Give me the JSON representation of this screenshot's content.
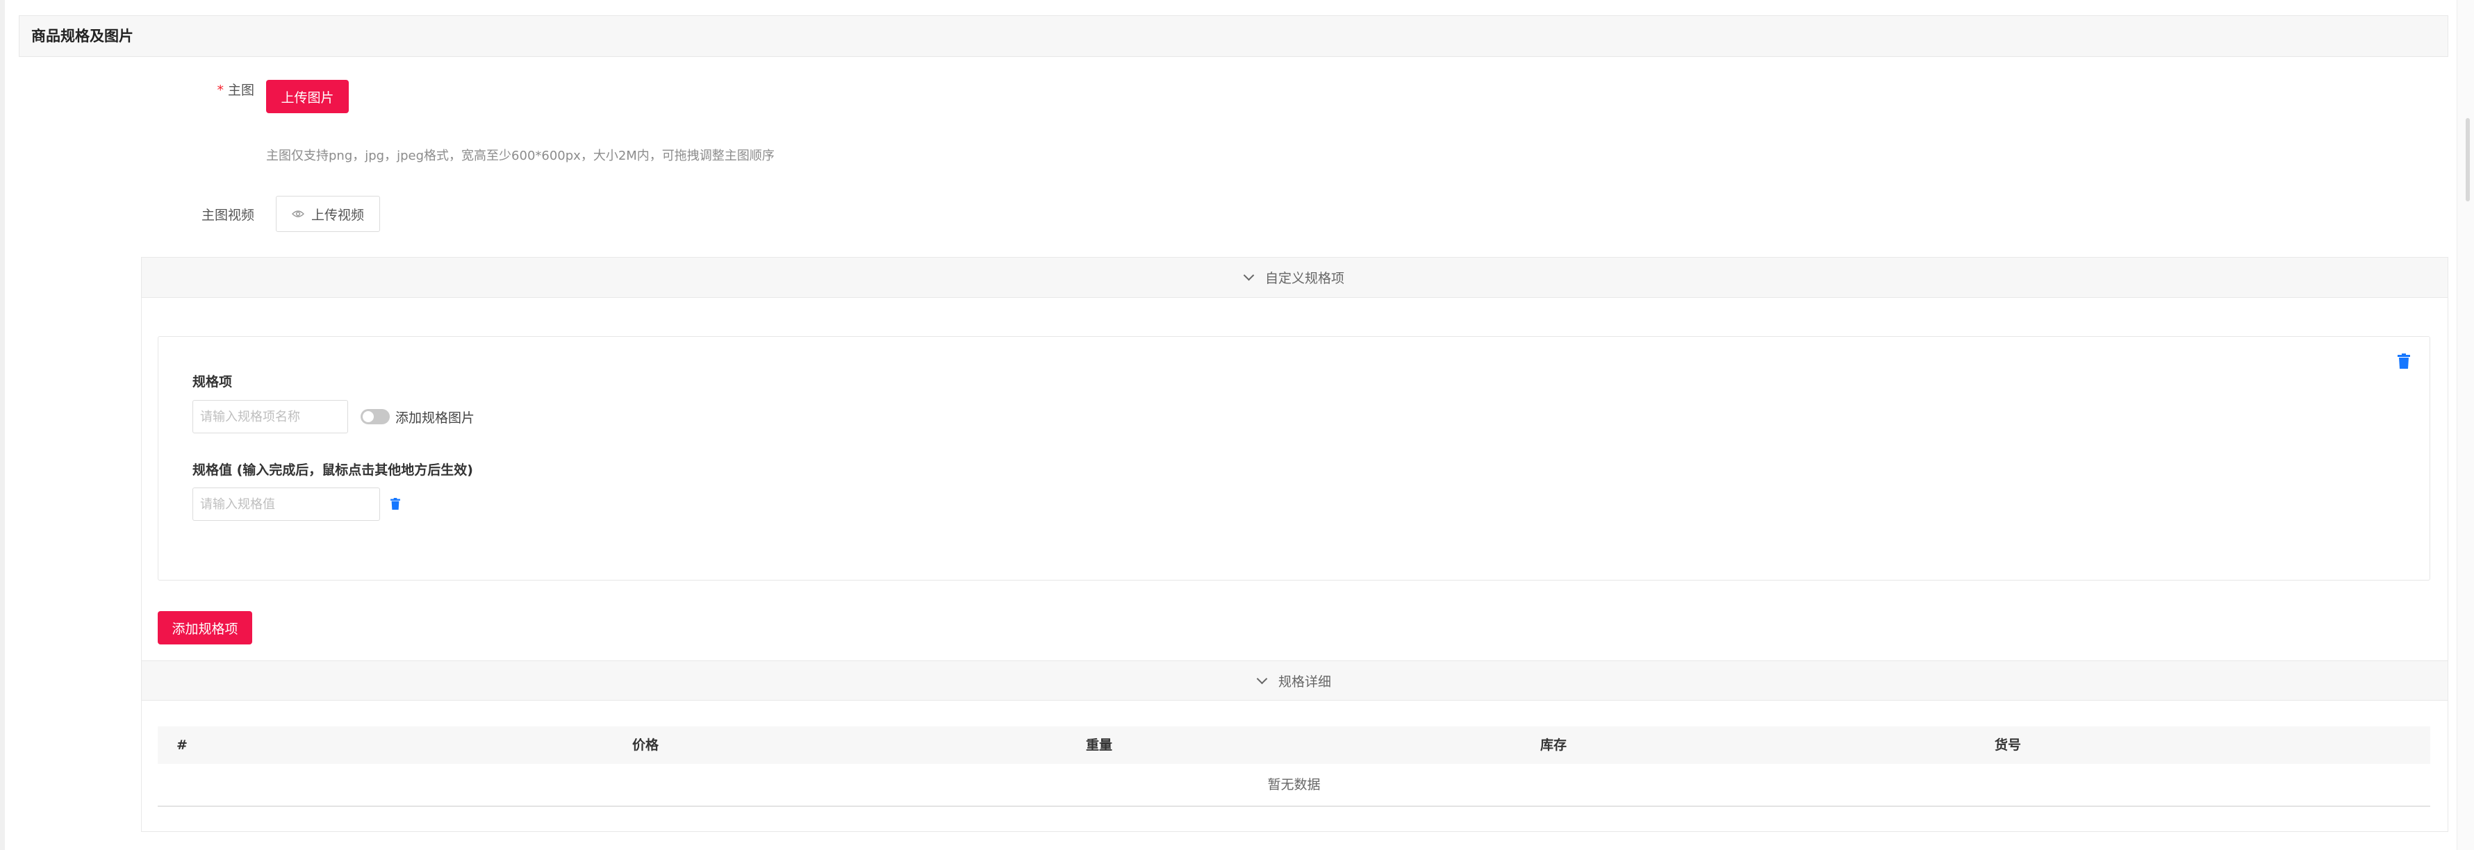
{
  "section": {
    "title": "商品规格及图片"
  },
  "main_image": {
    "label": "主图",
    "upload_button": "上传图片",
    "hint": "主图仅支持png，jpg，jpeg格式，宽高至少600*600px，大小2M内，可拖拽调整主图顺序"
  },
  "main_video": {
    "label": "主图视频",
    "upload_button": "上传视频"
  },
  "custom_spec": {
    "collapse_title": "自定义规格项",
    "spec_item_label": "规格项",
    "spec_name_placeholder": "请输入规格项名称",
    "add_image_toggle_label": "添加规格图片",
    "spec_value_label": "规格值 (输入完成后，鼠标点击其他地方后生效)",
    "spec_value_placeholder": "请输入规格值",
    "add_spec_button": "添加规格项"
  },
  "spec_detail": {
    "collapse_title": "规格详细",
    "columns": [
      "#",
      "价格",
      "重量",
      "库存",
      "货号"
    ],
    "empty_text": "暂无数据"
  },
  "colors": {
    "primary": "#f0144a",
    "trash_icon": "#1677ff"
  }
}
